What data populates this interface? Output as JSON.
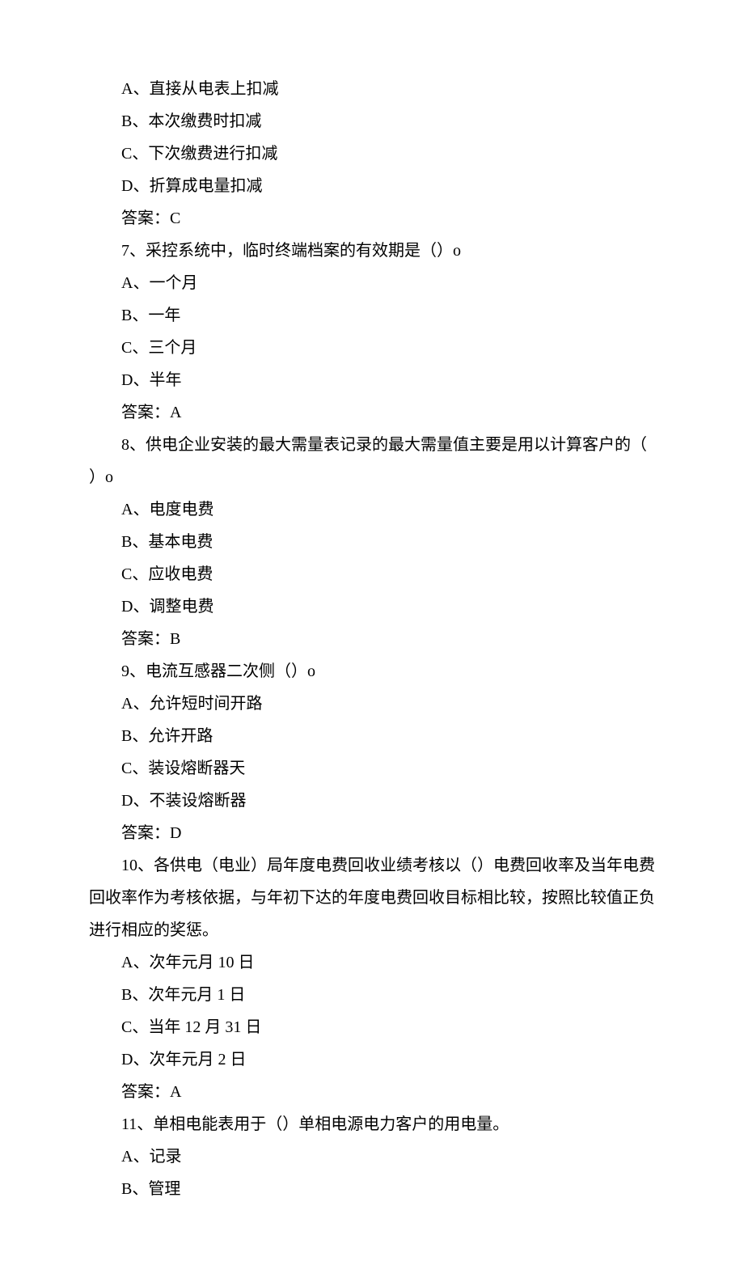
{
  "lines": [
    "A、直接从电表上扣减",
    "B、本次缴费时扣减",
    "C、下次缴费进行扣减",
    "D、折算成电量扣减",
    "答案：C",
    "7、采控系统中，临时终端档案的有效期是（）o",
    "A、一个月",
    "B、一年",
    "C、三个月",
    "D、半年",
    "答案：A",
    "8、供电企业安装的最大需量表记录的最大需量值主要是用以计算客户的（",
    {
      "text": "）o",
      "noIndent": true
    },
    "A、电度电费",
    "B、基本电费",
    "C、应收电费",
    "D、调整电费",
    "答案：B",
    "9、电流互感器二次侧（）o",
    "A、允许短时间开路",
    "B、允许开路",
    "C、装设熔断器天",
    "D、不装设熔断器",
    "答案：D",
    "10、各供电（电业）局年度电费回收业绩考核以（）电费回收率及当年电费",
    {
      "text": "回收率作为考核依据，与年初下达的年度电费回收目标相比较，按照比较值正负",
      "noIndent": true
    },
    {
      "text": "进行相应的奖惩。",
      "noIndent": true
    },
    "A、次年元月 10 日",
    "B、次年元月 1 日",
    "C、当年 12 月 31 日",
    "D、次年元月 2 日",
    "答案：A",
    "11、单相电能表用于（）单相电源电力客户的用电量。",
    "A、记录",
    "B、管理"
  ]
}
